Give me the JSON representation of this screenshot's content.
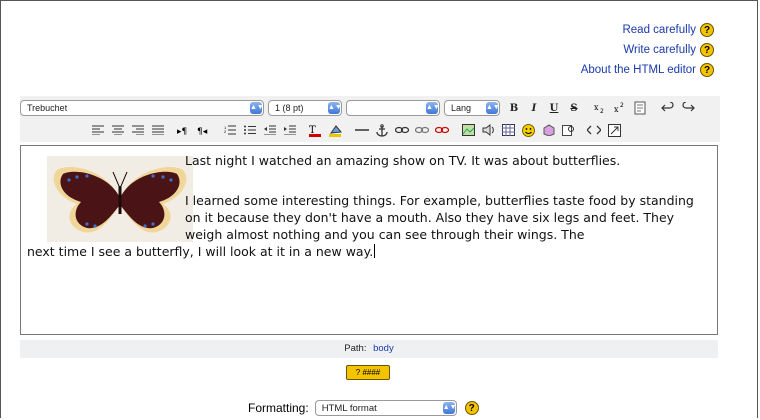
{
  "help_links": [
    {
      "label": "Read carefully"
    },
    {
      "label": "Write carefully"
    },
    {
      "label": "About the HTML editor"
    }
  ],
  "toolbar": {
    "font_select": "Trebuchet",
    "size_select": "1 (8 pt)",
    "style_select": "",
    "lang_label": "Lang",
    "bold": "B",
    "italic": "I",
    "underline": "U",
    "strike": "S"
  },
  "editor": {
    "para1": "Last night I watched an amazing show on TV. It was about butterflies.",
    "para2_a": "I learned some interesting things. For example, butterflies taste food by standing on it because they don't have a mouth. Also they have six legs and feet. They weigh almost nothing and you can see through their wings. The",
    "para2_b": "next time I see a butterfly, I will look at it in a new way."
  },
  "path": {
    "label": "Path:",
    "value": "body"
  },
  "resize_label": "? ####",
  "formatting": {
    "label": "Formatting:",
    "value": "HTML format"
  },
  "colors": {
    "link": "#1a3aa8",
    "help_icon": "#f3c300",
    "toolbar_bg": "#f1f1f1"
  }
}
